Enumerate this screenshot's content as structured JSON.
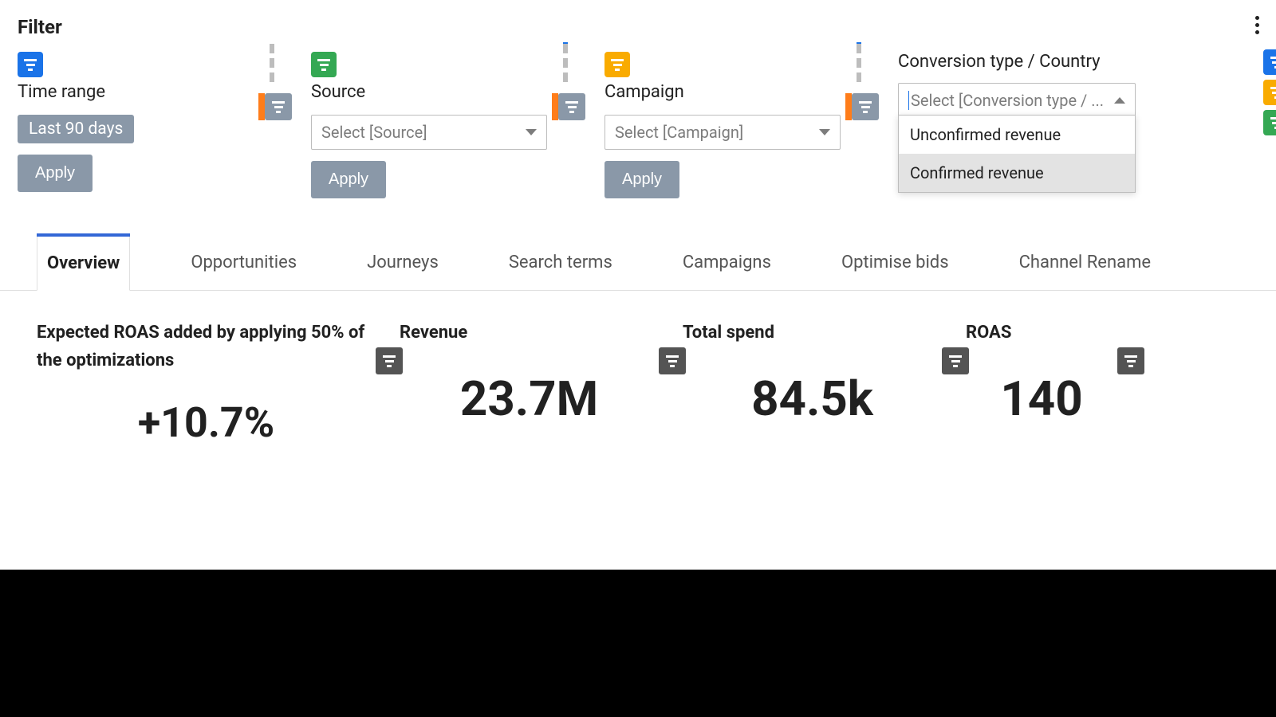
{
  "header": {
    "title": "Filter"
  },
  "filters": {
    "time_range": {
      "label": "Time range",
      "chip": "Last 90 days",
      "apply": "Apply"
    },
    "source": {
      "label": "Source",
      "placeholder": "Select [Source]",
      "apply": "Apply"
    },
    "campaign": {
      "label": "Campaign",
      "placeholder": "Select [Campaign]",
      "apply": "Apply"
    },
    "conversion": {
      "label": "Conversion type / Country",
      "placeholder": "Select [Conversion type / ...",
      "options": [
        "Unconfirmed revenue",
        "Confirmed revenue"
      ],
      "hovered_index": 1
    }
  },
  "tabs": [
    "Overview",
    "Opportunities",
    "Journeys",
    "Search terms",
    "Campaigns",
    "Optimise bids",
    "Channel Rename"
  ],
  "active_tab": "Overview",
  "kpis": [
    {
      "title": "Expected ROAS added by applying 50% of the optimizations",
      "value": "+10.7%"
    },
    {
      "title": "Revenue",
      "value": "23.7M"
    },
    {
      "title": "Total spend",
      "value": "84.5k"
    },
    {
      "title": "ROAS",
      "value": "140"
    }
  ]
}
